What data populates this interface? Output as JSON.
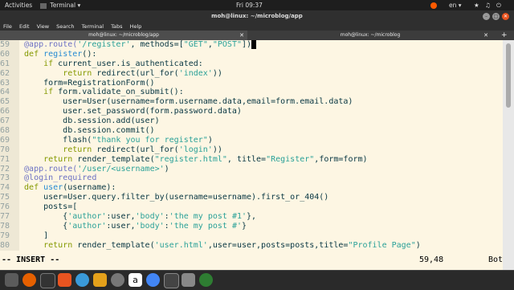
{
  "top_panel": {
    "activities": "Activities",
    "app_menu": "Terminal ▾",
    "clock": "Fri 09:37",
    "lang": "en ▾"
  },
  "window": {
    "title": "moh@linux: ~/microblog/app"
  },
  "menu": {
    "items": [
      "File",
      "Edit",
      "View",
      "Search",
      "Terminal",
      "Tabs",
      "Help"
    ]
  },
  "tabs": [
    {
      "label": "moh@linux: ~/microblog/app",
      "active": true
    },
    {
      "label": "moh@linux: ~/microblog",
      "active": false
    }
  ],
  "editor": {
    "lines": [
      {
        "n": "59",
        "t": "@app.route('/register', methods=[\"GET\",\"POST\"])"
      },
      {
        "n": "60",
        "t": "def register():"
      },
      {
        "n": "61",
        "t": "    if current_user.is_authenticated:"
      },
      {
        "n": "62",
        "t": "        return redirect(url_for('index'))"
      },
      {
        "n": "63",
        "t": "    form=RegistrationForm()"
      },
      {
        "n": "64",
        "t": "    if form.validate_on_submit():"
      },
      {
        "n": "65",
        "t": "        user=User(username=form.username.data,email=form.email.data)"
      },
      {
        "n": "66",
        "t": "        user.set_password(form.password.data)"
      },
      {
        "n": "67",
        "t": "        db.session.add(user)"
      },
      {
        "n": "68",
        "t": "        db.session.commit()"
      },
      {
        "n": "69",
        "t": "        flash(\"thank you for register\")"
      },
      {
        "n": "70",
        "t": "        return redirect(url_for('login'))"
      },
      {
        "n": "71",
        "t": "    return render_template(\"register.html\", title=\"Register\",form=form)"
      },
      {
        "n": "72",
        "t": "@app.route('/user/<username>')"
      },
      {
        "n": "73",
        "t": "@login_required"
      },
      {
        "n": "74",
        "t": "def user(username):"
      },
      {
        "n": "75",
        "t": "    user=User.query.filter_by(username=username).first_or_404()"
      },
      {
        "n": "76",
        "t": "    posts=["
      },
      {
        "n": "77",
        "t": "        {'author':user,'body':'the my post #1'},"
      },
      {
        "n": "78",
        "t": "        {'author':user,'body':'the my post #'}"
      },
      {
        "n": "79",
        "t": "    ]"
      },
      {
        "n": "80",
        "t": "    return render_template('user.html',user=user,posts=posts,title=\"Profile Page\")"
      }
    ],
    "mode": "-- INSERT --",
    "position": "59,48",
    "scroll": "Bot"
  },
  "colors": {
    "background": "#fdf6e3",
    "keyword": "#859900",
    "string": "#2aa198",
    "decorator": "#6c71c4"
  },
  "dock": {
    "icons": [
      "files-icon",
      "firefox-icon",
      "terminal-icon",
      "software-icon",
      "help-icon",
      "settings-icon",
      "amazon-icon",
      "chrome-icon",
      "terminal-active-icon",
      "screenshot-icon"
    ]
  }
}
